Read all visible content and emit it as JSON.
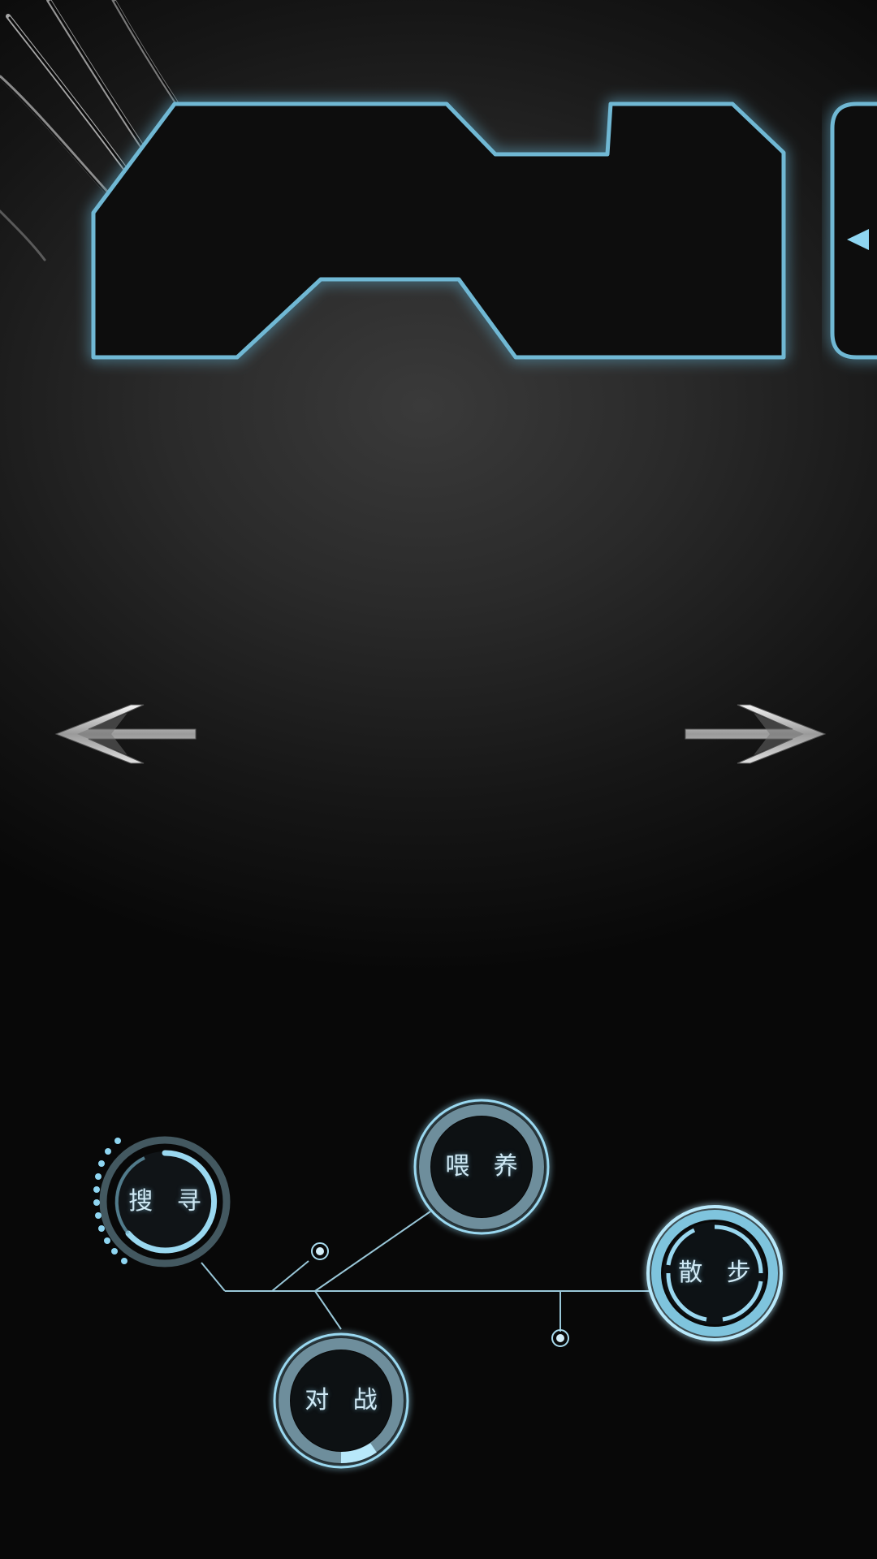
{
  "colors": {
    "accent": "#8fd6f2",
    "panel_glow": "#6fb8d4",
    "panel_fill": "#0c0c0c",
    "ring_dim": "#5f8393",
    "ring_bright": "#9ad8f0"
  },
  "top_panel": {
    "icon": "angular-display-panel"
  },
  "side_tab": {
    "icon": "triangle-left-icon"
  },
  "navigation": {
    "prev_icon": "arrow-left-icon",
    "next_icon": "arrow-right-icon"
  },
  "actions": {
    "search": {
      "label": "搜 寻",
      "icon": "dotted-ring-icon"
    },
    "feed": {
      "label": "喂 养",
      "icon": "ring-icon"
    },
    "walk": {
      "label": "散 步",
      "icon": "segmented-ring-icon"
    },
    "battle": {
      "label": "对 战",
      "icon": "ring-icon"
    }
  }
}
